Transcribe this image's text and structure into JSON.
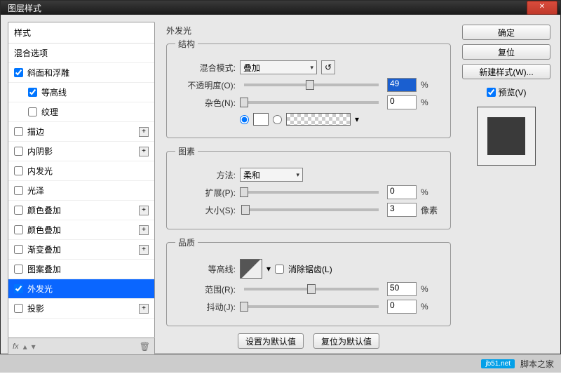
{
  "titlebar": {
    "title": "图层样式"
  },
  "left": {
    "header": "样式",
    "blending_options": "混合选项",
    "items": [
      {
        "label": "斜面和浮雕",
        "checked": true,
        "plus": false
      },
      {
        "label": "等高线",
        "checked": true,
        "indent": true
      },
      {
        "label": "纹理",
        "checked": false,
        "indent": true
      },
      {
        "label": "描边",
        "checked": false,
        "plus": true
      },
      {
        "label": "内阴影",
        "checked": false,
        "plus": true
      },
      {
        "label": "内发光",
        "checked": false
      },
      {
        "label": "光泽",
        "checked": false
      },
      {
        "label": "颜色叠加",
        "checked": false,
        "plus": true
      },
      {
        "label": "颜色叠加",
        "checked": false,
        "plus": true
      },
      {
        "label": "渐变叠加",
        "checked": false,
        "plus": true
      },
      {
        "label": "图案叠加",
        "checked": false
      },
      {
        "label": "外发光",
        "checked": true,
        "selected": true
      },
      {
        "label": "投影",
        "checked": false,
        "plus": true
      }
    ],
    "fx": "fx"
  },
  "center": {
    "section_title": "外发光",
    "structure": {
      "legend": "结构",
      "blend_mode_label": "混合模式:",
      "blend_mode_value": "叠加",
      "opacity_label": "不透明度(O):",
      "opacity_value": "49",
      "opacity_unit": "%",
      "noise_label": "杂色(N):",
      "noise_value": "0",
      "noise_unit": "%"
    },
    "elements": {
      "legend": "图素",
      "method_label": "方法:",
      "method_value": "柔和",
      "spread_label": "扩展(P):",
      "spread_value": "0",
      "spread_unit": "%",
      "size_label": "大小(S):",
      "size_value": "3",
      "size_unit": "像素"
    },
    "quality": {
      "legend": "品质",
      "contour_label": "等高线:",
      "antialias_label": "消除锯齿(L)",
      "range_label": "范围(R):",
      "range_value": "50",
      "range_unit": "%",
      "jitter_label": "抖动(J):",
      "jitter_value": "0",
      "jitter_unit": "%"
    },
    "buttons": {
      "make_default": "设置为默认值",
      "reset_default": "复位为默认值"
    }
  },
  "right": {
    "ok": "确定",
    "cancel": "复位",
    "new_style": "新建样式(W)...",
    "preview": "预览(V)"
  },
  "footer": {
    "badge": "jb51.net",
    "site": "脚本之家"
  },
  "chart_data": null
}
